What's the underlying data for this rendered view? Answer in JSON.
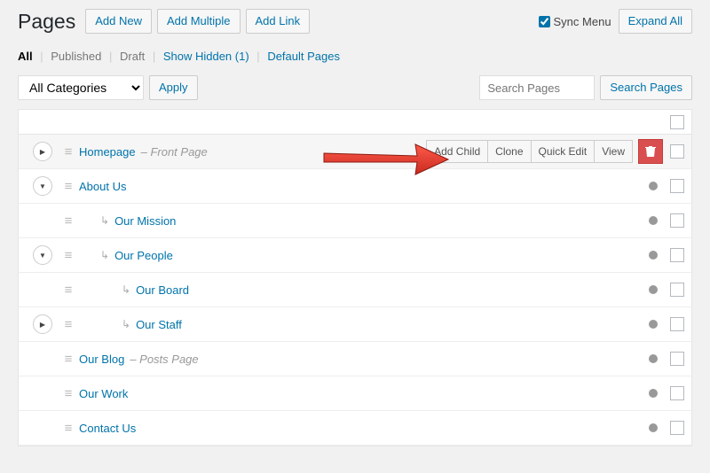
{
  "header": {
    "title": "Pages",
    "add_new": "Add New",
    "add_multiple": "Add Multiple",
    "add_link": "Add Link",
    "sync_menu": "Sync Menu",
    "expand_all": "Expand All"
  },
  "filters": {
    "all": "All",
    "published": "Published",
    "draft": "Draft",
    "show_hidden": "Show Hidden",
    "show_hidden_count": "(1)",
    "default_pages": "Default Pages"
  },
  "toolbar": {
    "category_select": "All Categories",
    "apply": "Apply",
    "search_placeholder": "Search Pages",
    "search_button": "Search Pages"
  },
  "row_actions": {
    "add_child": "Add Child",
    "clone": "Clone",
    "quick_edit": "Quick Edit",
    "view": "View"
  },
  "pages": [
    {
      "title": "Homepage",
      "annotation": "Front Page",
      "expandable": true,
      "expanded": false,
      "indent": 0,
      "highlighted": true,
      "show_actions": true,
      "no_status_dot": true,
      "has_child_arrow": false
    },
    {
      "title": "About Us",
      "annotation": "",
      "expandable": true,
      "expanded": true,
      "indent": 0,
      "has_child_arrow": false
    },
    {
      "title": "Our Mission",
      "annotation": "",
      "expandable": false,
      "indent": 1,
      "has_child_arrow": true
    },
    {
      "title": "Our People",
      "annotation": "",
      "expandable": true,
      "expanded": true,
      "indent": 1,
      "has_child_arrow": true
    },
    {
      "title": "Our Board",
      "annotation": "",
      "expandable": false,
      "indent": 2,
      "has_child_arrow": true
    },
    {
      "title": "Our Staff",
      "annotation": "",
      "expandable": true,
      "expanded": false,
      "indent": 2,
      "has_child_arrow": true
    },
    {
      "title": "Our Blog",
      "annotation": "Posts Page",
      "expandable": false,
      "indent": 0,
      "has_child_arrow": false,
      "has_handle": true
    },
    {
      "title": "Our Work",
      "annotation": "",
      "expandable": false,
      "indent": 0,
      "has_child_arrow": false,
      "has_handle": true
    },
    {
      "title": "Contact Us",
      "annotation": "",
      "expandable": false,
      "indent": 0,
      "has_child_arrow": false,
      "has_handle": true
    }
  ]
}
